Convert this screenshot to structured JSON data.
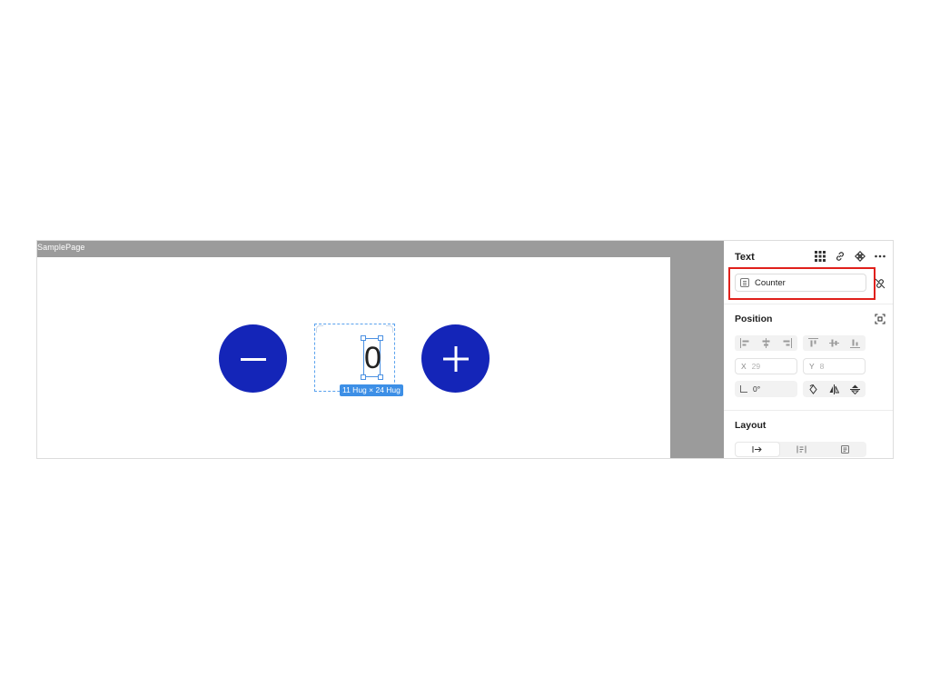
{
  "canvas": {
    "page_label": "SamplePage",
    "minus_icon": "minus-icon",
    "plus_icon": "plus-icon",
    "counter_value": "0",
    "size_badge": "11 Hug × 24 Hug",
    "button_color": "#1425b8",
    "selection_color": "#3d8fe6"
  },
  "panel": {
    "title": "Text",
    "header_icons": [
      "grid-icon",
      "link-icon",
      "component-icon",
      "more-icon"
    ],
    "name_field": {
      "value": "Counter",
      "icon": "text-tag-icon"
    },
    "highlight_color": "#e0201b",
    "position": {
      "title": "Position",
      "x_label": "X",
      "x_value": "29",
      "y_label": "Y",
      "y_value": "8",
      "rotation": "0°"
    },
    "layout": {
      "title": "Layout"
    }
  }
}
